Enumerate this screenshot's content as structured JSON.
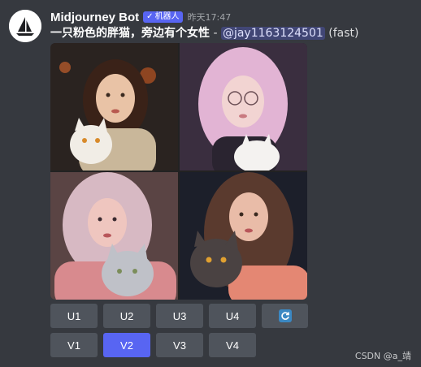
{
  "author": {
    "name": "Midjourney Bot",
    "badge": "机器人",
    "timestamp": "昨天17:47"
  },
  "message": {
    "prompt": "一只粉色的胖猫，旁边有个女性",
    "separator": " - ",
    "mention": "@jay1163124501",
    "mode": "(fast)"
  },
  "images": [
    {
      "icon": "portrait-with-cat",
      "palette": {
        "bg": "#2a2320",
        "hair": "#3a2218",
        "shirt": "#c9b79a"
      }
    },
    {
      "icon": "portrait-with-cat",
      "palette": {
        "bg": "#3a2e3f",
        "hair": "#e2b4d4",
        "shirt": "#2a2430"
      }
    },
    {
      "icon": "portrait-with-cat",
      "palette": {
        "bg": "#5a4444",
        "hair": "#d7b9c3",
        "shirt": "#d88a8e"
      }
    },
    {
      "icon": "portrait-with-cat",
      "palette": {
        "bg": "#1c1f2a",
        "hair": "#5a3a2e",
        "shirt": "#e48773"
      }
    }
  ],
  "buttons": {
    "upscale": [
      "U1",
      "U2",
      "U3",
      "U4"
    ],
    "variation": [
      "V1",
      "V2",
      "V3",
      "V4"
    ],
    "reroll_icon": "refresh-icon",
    "active": "V2"
  },
  "watermark": "CSDN @a_靖",
  "colors": {
    "background": "#36393f",
    "button": "#4f545c",
    "accent": "#5865f2",
    "mention_bg": "#414675"
  }
}
